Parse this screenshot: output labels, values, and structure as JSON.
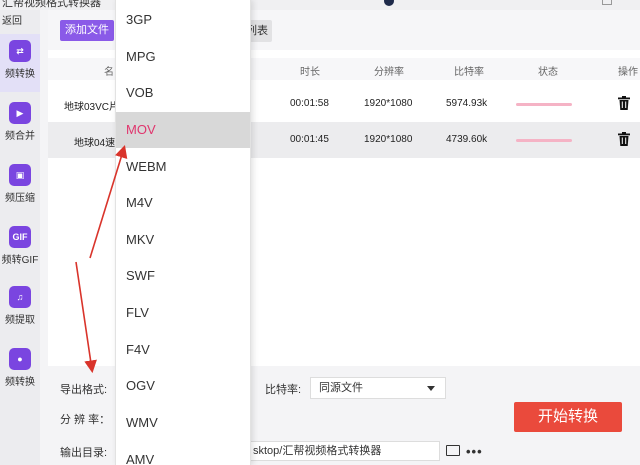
{
  "window": {
    "title": "汇帮视频格式转换器"
  },
  "sidebar": {
    "back_label": "返回",
    "items": [
      {
        "label": "频转换",
        "icon": "video-convert-icon",
        "glyph": "⇄"
      },
      {
        "label": "频合并",
        "icon": "video-merge-icon",
        "glyph": "▶"
      },
      {
        "label": "频压缩",
        "icon": "video-compress-icon",
        "glyph": "▣"
      },
      {
        "label": "频转GIF",
        "icon": "gif-icon",
        "glyph": "GIF"
      },
      {
        "label": "频提取",
        "icon": "music-extract-icon",
        "glyph": "♫"
      },
      {
        "label": "频转换",
        "icon": "microphone-icon",
        "glyph": "●"
      }
    ]
  },
  "toolbar": {
    "add_file": "添加文件",
    "clear_list": "列表"
  },
  "table": {
    "headers": {
      "name": "名",
      "duration": "时长",
      "resolution": "分辨率",
      "bitrate": "比特率",
      "status": "状态",
      "action": "操作"
    },
    "rows": [
      {
        "name": "地球03VC片",
        "duration": "00:01:58",
        "resolution": "1920*1080",
        "bitrate": "5974.93k"
      },
      {
        "name": "地球04速",
        "duration": "00:01:45",
        "resolution": "1920*1080",
        "bitrate": "4739.60k"
      }
    ]
  },
  "bottom": {
    "export_format_label": "导出格式:",
    "bitrate_label": "比特率:",
    "bitrate_value": "同源文件",
    "resolution_label": "分 辨 率：",
    "output_dir_label": "输出目录:",
    "output_dir_value": "sktop/汇帮视频格式转换器",
    "more": "•••",
    "start_button": "开始转换"
  },
  "format_dropdown": {
    "options": [
      "3GP",
      "MPG",
      "VOB",
      "MOV",
      "WEBM",
      "M4V",
      "MKV",
      "SWF",
      "FLV",
      "F4V",
      "OGV",
      "WMV",
      "AMV"
    ],
    "selected": "MOV"
  },
  "colors": {
    "accent": "#8a5ae8",
    "start": "#ea4a3c",
    "selected_text": "#e0356d",
    "annotation": "#d9342b"
  }
}
